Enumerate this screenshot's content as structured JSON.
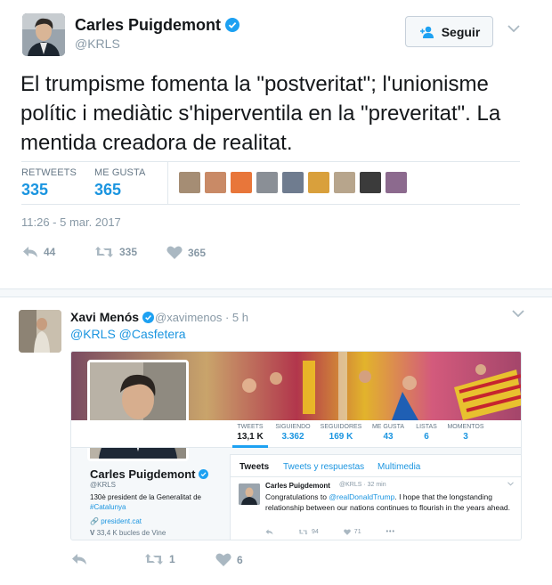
{
  "main_tweet": {
    "author_name": "Carles Puigdemont",
    "author_handle": "@KRLS",
    "follow_label": "Seguir",
    "text": "El trumpisme fomenta la \"postveritat\"; l'unionisme polític i mediàtic s'hiperventila en la \"preveritat\". La mentida creadora de realitat.",
    "retweets_label": "RETWEETS",
    "retweets_count": "335",
    "likes_label": "ME GUSTA",
    "likes_count": "365",
    "timestamp": "11:26 - 5 mar. 2017",
    "actions": {
      "replies": "44",
      "retweets": "335",
      "likes": "365"
    }
  },
  "reply_tweet": {
    "author_name": "Xavi Menós",
    "author_handle": "@xavimenos",
    "time": "· 5 h",
    "mentions": "@KRLS @Casfetera",
    "actions": {
      "retweets": "1",
      "likes": "6"
    }
  },
  "embedded_profile": {
    "stats": [
      {
        "label": "TWEETS",
        "value": "13,1 K"
      },
      {
        "label": "SIGUIENDO",
        "value": "3.362"
      },
      {
        "label": "SEGUIDORES",
        "value": "169 K"
      },
      {
        "label": "ME GUSTA",
        "value": "43"
      },
      {
        "label": "LISTAS",
        "value": "6"
      },
      {
        "label": "MOMENTOS",
        "value": "3"
      }
    ],
    "name": "Carles Puigdemont",
    "handle": "@KRLS",
    "bio_line1": "130è president de la Generalitat de",
    "bio_line2": "#Catalunya",
    "link": "president.cat",
    "vine": "33,4 K bucles de Vine",
    "tabs": [
      "Tweets",
      "Tweets y respuestas",
      "Multimedia"
    ],
    "tweet": {
      "name": "Carles Puigdemont",
      "meta": "@KRLS · 32 min",
      "text_before": "Congratulations to ",
      "mention": "@realDonaldTrump",
      "text_after": ". I hope that the longstanding relationship between our nations continues to flourish in the years ahead.",
      "retweets": "94",
      "likes": "71"
    }
  },
  "colors": {
    "accent": "#1da1f2",
    "link": "#1b95e0",
    "muted": "#8899a6"
  }
}
